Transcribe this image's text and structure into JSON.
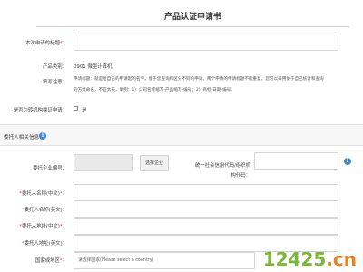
{
  "page": {
    "title": "产品认证申请书"
  },
  "fields": {
    "title_label": "本次申请的标题",
    "title_value": "",
    "category_label": "产品类别：",
    "category_value": "0901  微型计算机",
    "notes_label": "填写注意：",
    "notes_text_1": "申请标题：就是给自己的申请起的名字，便于您查询和区分不同的申请，两个申请的申请标题不能重复。您可以采用便于自己统计和查询",
    "notes_text_2": "的方式命名，不宜太长，举例：1）公司名称缩写-产品缩写-编号；2）商标-日期-编号。",
    "moved_label": "是否为转机构换证申请：",
    "moved_option": "是"
  },
  "section": {
    "title": "委托人相关信息",
    "icon": "info-icon"
  },
  "client": {
    "company_no_label": "委托企业编号：",
    "company_no_value": "",
    "select_button": "选择企业",
    "credit_code_label_1": "统一社会信用代码/组织机",
    "credit_code_label_2": "构代码：",
    "credit_code_value": "",
    "name_cn_label": "委托人名称(中文)",
    "name_en_label": "委托人名称(英文)",
    "addr_cn_label": "委托人地址(中文)",
    "addr_en_label": "委托人地址(英文)",
    "country_label": "国家或地区",
    "country_placeholder": "请选择国家(Please select a country)"
  },
  "watermark": {
    "number": "12425",
    "dot": ".",
    "suffix": "cn"
  },
  "colors": {
    "required": "#e23a2e",
    "info": "#3d89d5",
    "watermark_green": "#7bb83a",
    "watermark_orange": "#e8821c"
  }
}
